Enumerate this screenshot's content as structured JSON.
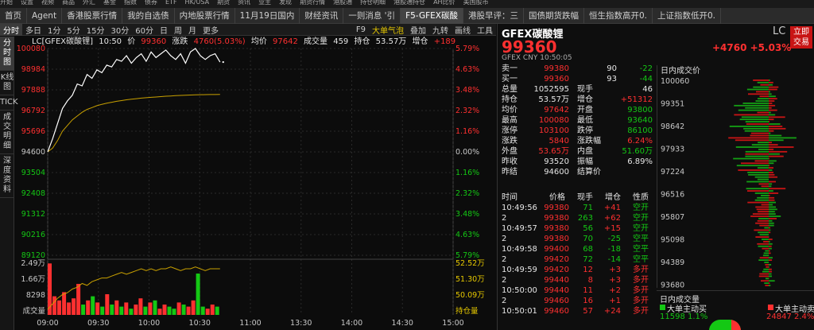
{
  "top_menu": [
    "开始",
    "设置",
    "视频",
    "商品",
    "外汇",
    "基金",
    "指数",
    "债券",
    "ETF",
    "HK/USA",
    "期货",
    "资讯",
    "业主",
    "发现",
    "",
    "期货行情",
    "港股通",
    "持仓明细",
    "",
    "港股通持仓",
    "AH比价",
    "",
    "美国股市"
  ],
  "tabs": [
    "首页",
    "Agent",
    "香港股票行情",
    "我的自选债",
    "内地股票行情",
    "11月19日国内",
    "财经资讯",
    "一则消息 '引",
    "F5-GFEX碳酸",
    "港股早评：三",
    "国债期货跌幅",
    "恒生指数高开0.",
    "上证指数低开0."
  ],
  "active_tab": 8,
  "sidebar": [
    "分时图",
    "K线图",
    "TICK",
    "成交明细",
    "深度资料"
  ],
  "chart_toolbar": {
    "items": [
      "分时",
      "多日",
      "1分",
      "5分",
      "15分",
      "30分",
      "60分",
      "日",
      "周",
      "月",
      "更多"
    ],
    "right_items": [
      "F9",
      "大单气泡",
      "叠加",
      "九转",
      "画线",
      "工具"
    ]
  },
  "info": {
    "name": "LC[GFEX碳酸锂]",
    "time": "10:50",
    "price_label": "价",
    "price": "99360",
    "chg_label": "涨跌",
    "chg": "4760(5.03%)",
    "avg_label": "均价",
    "avg": "97642",
    "vol_label": "成交量",
    "vol": "459",
    "oi_label": "持仓",
    "oi": "53.57万",
    "inc_label": "增仓",
    "inc": "+189"
  },
  "chart_data": {
    "type": "line",
    "x_ticks": [
      "09:00",
      "09:30",
      "10:00",
      "10:30",
      "11:00",
      "13:30",
      "14:00",
      "14:30",
      "15:00"
    ],
    "y_left": [
      "100080",
      "98984",
      "97888",
      "96792",
      "95696",
      "94600",
      "93504",
      "92408",
      "91312",
      "90216",
      "89120"
    ],
    "y_right": [
      "5.79%",
      "4.63%",
      "3.48%",
      "2.32%",
      "1.16%",
      "0.00%",
      "1.16%",
      "2.32%",
      "3.48%",
      "4.63%",
      "5.79%"
    ],
    "ylim": [
      89120,
      100080
    ],
    "prev_settle": 94600,
    "price": [
      94600,
      95300,
      96100,
      96900,
      97300,
      97600,
      98200,
      98100,
      98700,
      98500,
      98950,
      98800,
      99200,
      99100,
      99500,
      99400,
      99700,
      99300,
      99600,
      99800,
      99400,
      99900,
      99600,
      99800,
      100000,
      99700,
      99500,
      99800,
      99300,
      99900,
      100080,
      99700,
      99500,
      99700,
      99800,
      99360
    ],
    "avg": [
      94600,
      94800,
      95200,
      95700,
      96000,
      96300,
      96500,
      96700,
      96850,
      96950,
      97050,
      97120,
      97180,
      97230,
      97280,
      97320,
      97360,
      97390,
      97420,
      97450,
      97470,
      97490,
      97510,
      97530,
      97550,
      97565,
      97580,
      97595,
      97605,
      97615,
      97625,
      97632,
      97636,
      97639,
      97641,
      97642
    ],
    "vol_labels": [
      "2.49万",
      "1.66万",
      "8298",
      "成交量"
    ],
    "oi_labels": [
      "52.52万",
      "51.30万",
      "50.09万",
      "持仓量"
    ],
    "oi_values": [
      50.3,
      50.6,
      50.9,
      51.1,
      51.2,
      51.4,
      51.5,
      51.7,
      51.6,
      51.8,
      51.9,
      52.0,
      52.0,
      52.1,
      52.2,
      52.3,
      52.2,
      52.3,
      52.4,
      52.5,
      52.4,
      52.5,
      52.4,
      52.5,
      52.5,
      52.6,
      52.5,
      52.4,
      52.5,
      52.5,
      52.6,
      52.5,
      52.4,
      52.5,
      52.5,
      52.5
    ],
    "volume": [
      24900,
      9000,
      7000,
      11000,
      6000,
      8000,
      15000,
      5000,
      7000,
      9000,
      6000,
      4000,
      10000,
      5000,
      7000,
      4000,
      6000,
      3000,
      5000,
      8000,
      4000,
      6000,
      7000,
      3000,
      5000,
      4000,
      3000,
      6000,
      5000,
      4000,
      7000,
      20000,
      4000,
      3000,
      5000,
      4000
    ],
    "vol_max": 25000,
    "oi_range": [
      50.0,
      52.8
    ]
  },
  "quote": {
    "name": "GFEX碳酸锂",
    "price": "99360",
    "code": "LC",
    "sub": "GFEX  CNY  10:50:05",
    "chg": "+4760  +5.03%",
    "btn": "立即交易",
    "ask": {
      "label": "卖一",
      "price": "99380",
      "vol": "90",
      "chg": "-22"
    },
    "bid": {
      "label": "买一",
      "price": "99360",
      "vol": "93",
      "chg": "-44"
    },
    "stats": [
      [
        "总量",
        "1052595",
        "现手",
        "46"
      ],
      [
        "持仓",
        "53.57万",
        "增仓",
        "+51312"
      ],
      [
        "均价",
        "97642",
        "开盘",
        "93800"
      ],
      [
        "最高",
        "100080",
        "最低",
        "93640"
      ],
      [
        "涨停",
        "103100",
        "跌停",
        "86100"
      ],
      [
        "涨跌",
        "5840",
        "涨跌幅",
        "6.24%"
      ],
      [
        "外盘",
        "53.65万",
        "内盘",
        "51.60万"
      ],
      [
        "昨收",
        "93520",
        "振幅",
        "6.89%"
      ],
      [
        "昨结",
        "94600",
        "结算价",
        ""
      ]
    ],
    "tick_header": [
      "时间",
      "价格",
      "现手",
      "增仓",
      "性质"
    ],
    "ticks": [
      [
        "10:49:56",
        "99380",
        "71",
        "+41",
        "空开"
      ],
      [
        "2",
        "99380",
        "263",
        "+62",
        "空开"
      ],
      [
        "10:49:57",
        "99380",
        "56",
        "+15",
        "空开"
      ],
      [
        "2",
        "99380",
        "70",
        "-25",
        "空平"
      ],
      [
        "10:49:58",
        "99400",
        "68",
        "-18",
        "空平"
      ],
      [
        "2",
        "99420",
        "72",
        "-14",
        "空平"
      ],
      [
        "10:49:59",
        "99420",
        "12",
        "+3",
        "多开"
      ],
      [
        "2",
        "99440",
        "8",
        "+3",
        "多开"
      ],
      [
        "10:50:00",
        "99440",
        "11",
        "+2",
        "多开"
      ],
      [
        "2",
        "99460",
        "16",
        "+1",
        "多开"
      ],
      [
        "10:50:01",
        "99460",
        "57",
        "+24",
        "多开"
      ]
    ]
  },
  "dom": {
    "title": "日内成交价",
    "levels": [
      "100060",
      "99351",
      "98642",
      "97933",
      "97224",
      "96516",
      "95807",
      "95098",
      "94389",
      "93680"
    ],
    "vol_title": "日内成交量",
    "active_buy_label": "大单主动买",
    "active_buy": "11598",
    "active_buy_pct": "1.1%",
    "active_sell_label": "大单主动卖",
    "active_sell": "24847",
    "active_sell_pct": "2.4%"
  },
  "colors": {
    "up": "#ff3030",
    "down": "#14c814",
    "avg": "#c8a000",
    "price_line": "#ffffff"
  }
}
